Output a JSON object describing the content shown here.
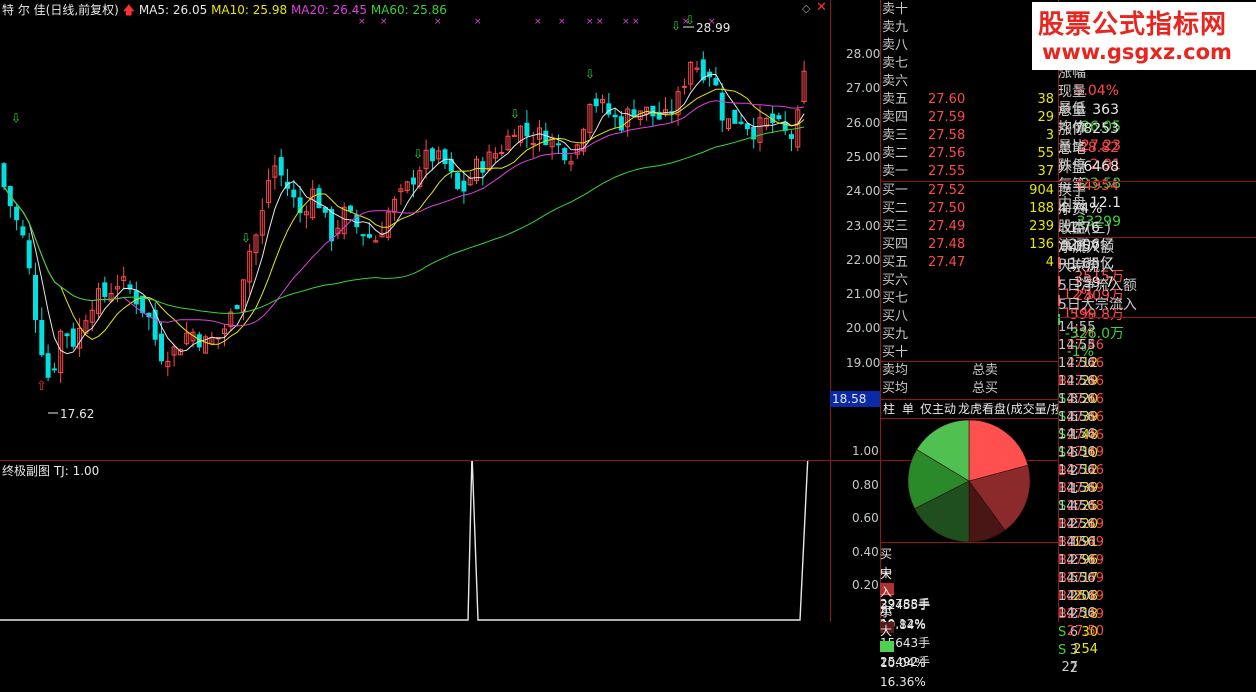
{
  "header": {
    "stock_name": "特 尔 佳",
    "period": "(日线,前复权)",
    "ma5_label": "MA5: 26.05",
    "ma10_label": "MA10: 25.98",
    "ma20_label": "MA20: 26.45",
    "ma60_label": "MA60: 25.86",
    "colors": {
      "ma5": "#e8e8e8",
      "ma10": "#e8e800",
      "ma20": "#e040e0",
      "ma60": "#3ad23a",
      "up": "#ff4a4a",
      "down": "#00e0e0",
      "frame": "#8a1a1a"
    }
  },
  "price_axis": [
    "28.00",
    "27.00",
    "26.00",
    "25.00",
    "24.00",
    "23.00",
    "22.00",
    "21.00",
    "20.00",
    "19.00",
    "18.00"
  ],
  "price_tag": "18.58",
  "annotations": {
    "high": "28.99",
    "low": "17.62"
  },
  "sub_chart": {
    "title": "终极副图",
    "tj_label": "TJ: 1.00",
    "axis": [
      "1.00",
      "0.80",
      "0.60",
      "0.40",
      "0.20"
    ]
  },
  "order_book": {
    "sell": [
      {
        "label": "卖十",
        "price": "",
        "vol": ""
      },
      {
        "label": "卖九",
        "price": "",
        "vol": ""
      },
      {
        "label": "卖八",
        "price": "",
        "vol": ""
      },
      {
        "label": "卖七",
        "price": "",
        "vol": ""
      },
      {
        "label": "卖六",
        "price": "",
        "vol": ""
      },
      {
        "label": "卖五",
        "price": "27.60",
        "vol": "38"
      },
      {
        "label": "卖四",
        "price": "27.59",
        "vol": "29"
      },
      {
        "label": "卖三",
        "price": "27.58",
        "vol": "3"
      },
      {
        "label": "卖二",
        "price": "27.56",
        "vol": "55"
      },
      {
        "label": "卖一",
        "price": "27.55",
        "vol": "37"
      }
    ],
    "buy": [
      {
        "label": "买一",
        "price": "27.52",
        "vol": "904"
      },
      {
        "label": "买二",
        "price": "27.50",
        "vol": "188"
      },
      {
        "label": "买三",
        "price": "27.49",
        "vol": "239"
      },
      {
        "label": "买四",
        "price": "27.48",
        "vol": "136"
      },
      {
        "label": "买五",
        "price": "27.47",
        "vol": "4"
      },
      {
        "label": "买六",
        "price": "",
        "vol": ""
      },
      {
        "label": "买七",
        "price": "",
        "vol": ""
      },
      {
        "label": "买八",
        "price": "",
        "vol": ""
      },
      {
        "label": "买九",
        "price": "",
        "vol": ""
      },
      {
        "label": "买十",
        "price": "",
        "vol": ""
      }
    ],
    "avg_sell_label": "卖均",
    "avg_buy_label": "买均",
    "total_sell_label": "总卖",
    "total_buy_label": "总买"
  },
  "tabs": [
    "柱",
    "单",
    "仅主动",
    "龙虎看盘(成交量/按"
  ],
  "flow_legend": [
    {
      "side": "买",
      "size": "大",
      "color": "#ff5050",
      "vol": "32455手",
      "pct": "20.84%"
    },
    {
      "side": "",
      "size": "中",
      "color": "#b03030",
      "vol": "29788手",
      "pct": "19.12%"
    },
    {
      "side": "入",
      "size": "小",
      "color": "#5a1a1a",
      "vol": "15643手",
      "pct": "10.04%"
    },
    {
      "side": "卖",
      "size": "大",
      "color": "#50d050",
      "vol": "25492手",
      "pct": "16.36%"
    }
  ],
  "pie": [
    {
      "value": 20.84,
      "color": "#ff5050"
    },
    {
      "value": 19.12,
      "color": "#8a2a2a"
    },
    {
      "value": 10.04,
      "color": "#4a1515"
    },
    {
      "value": 17.5,
      "color": "#1f4f1f"
    },
    {
      "value": 16.14,
      "color": "#2a8a2a"
    },
    {
      "value": 16.36,
      "color": "#50c050"
    }
  ],
  "watermark": {
    "title": "股票公式指标网",
    "url": "www.gsgxz.com"
  },
  "quotes": [
    {
      "l1": "涨幅",
      "v1": "5.04%",
      "c1": "red",
      "l2": "最低",
      "v2": "26.05",
      "c2": "green"
    },
    {
      "l1": "现量",
      "v1": "363",
      "c1": "white",
      "l2": "均价",
      "v2": "27.23",
      "c2": "red"
    },
    {
      "l1": "总量",
      "v1": "78253",
      "c1": "white",
      "l2": "量比",
      "v2": "2.91",
      "c2": "red"
    },
    {
      "l1": "涨停",
      "v1": "28.82",
      "c1": "red",
      "l2": "跌停",
      "v2": "23.58",
      "c2": "green"
    },
    {
      "l1": "总笔",
      "v1": "6468",
      "c1": "white",
      "l2": "每笔",
      "v2": "12.1",
      "c2": "white"
    },
    {
      "l1": "外盘",
      "v1": "44954",
      "c1": "red",
      "l2": "内盘",
      "v2": "33299",
      "c2": "green"
    }
  ],
  "fund": [
    {
      "l1": "换手",
      "v1": "4.74%",
      "l2": "股本",
      "v2": "2.06亿"
    },
    {
      "l1": "净资",
      "v1": "1.76",
      "l2": "流通",
      "v2": "1.65亿"
    },
    {
      "l1": "收益(三)",
      "v1": "0.057",
      "l2": "PE(动)",
      "v2": "359.7"
    }
  ],
  "flows": [
    {
      "label": "净流入额",
      "val": "2515万",
      "pct": "12%",
      "c": "red"
    },
    {
      "label": "大宗流入",
      "val": "2309万",
      "pct": "11%",
      "c": "red"
    },
    {
      "label": "5日净流入额",
      "val": "599.8万",
      "pct": "1%",
      "c": "red"
    },
    {
      "label": "5日大宗流入",
      "val": "-326.0万",
      "pct": "-1%",
      "c": "green"
    }
  ],
  "ticks": [
    {
      "t": "14:55",
      "p": "27.46",
      "v": "12",
      "d": "B",
      "n": "3"
    },
    {
      "t": "14:55",
      "p": "27.46",
      "v": "29",
      "d": "S",
      "n": "6"
    },
    {
      "t": "14:56",
      "p": "27.46",
      "v": "20",
      "d": "S",
      "n": "1"
    },
    {
      "t": "14:56",
      "p": "27.46",
      "v": "39",
      "d": "S",
      "n": "5"
    },
    {
      "t": "14:56",
      "p": "27.46",
      "v": "48",
      "d": "S",
      "n": "2"
    },
    {
      "t": "14:56",
      "p": "27.46",
      "v": "10",
      "d": "B",
      "n": "1"
    },
    {
      "t": "14:56",
      "p": "27.49",
      "v": "12",
      "d": "B",
      "n": "4"
    },
    {
      "t": "14:56",
      "p": "27.46",
      "v": "39",
      "d": "S",
      "n": "2"
    },
    {
      "t": "14:56",
      "p": "27.49",
      "v": "25",
      "d": "B",
      "n": "1"
    },
    {
      "t": "14:56",
      "p": "27.48",
      "v": "20",
      "d": "B",
      "n": "2"
    },
    {
      "t": "14:56",
      "p": "27.49",
      "v": "191",
      "d": "B",
      "n": "5"
    },
    {
      "t": "14:56",
      "p": "27.49",
      "v": "96",
      "d": "B",
      "n": "2"
    },
    {
      "t": "14:56",
      "p": "27.49",
      "v": "17",
      "d": "B",
      "n": "2"
    },
    {
      "t": "14:56",
      "p": "27.49",
      "v": "208",
      "d": "B",
      "n": "6"
    },
    {
      "t": "14:56",
      "p": "27.49",
      "v": "18",
      "d": "S",
      "n": "3"
    },
    {
      "t": "14:56",
      "p": "27.49",
      "v": "30",
      "d": "S",
      "n": "2"
    },
    {
      "t": "14:56",
      "p": "27.50",
      "v": "254",
      "d": "",
      "n": "27"
    }
  ]
}
